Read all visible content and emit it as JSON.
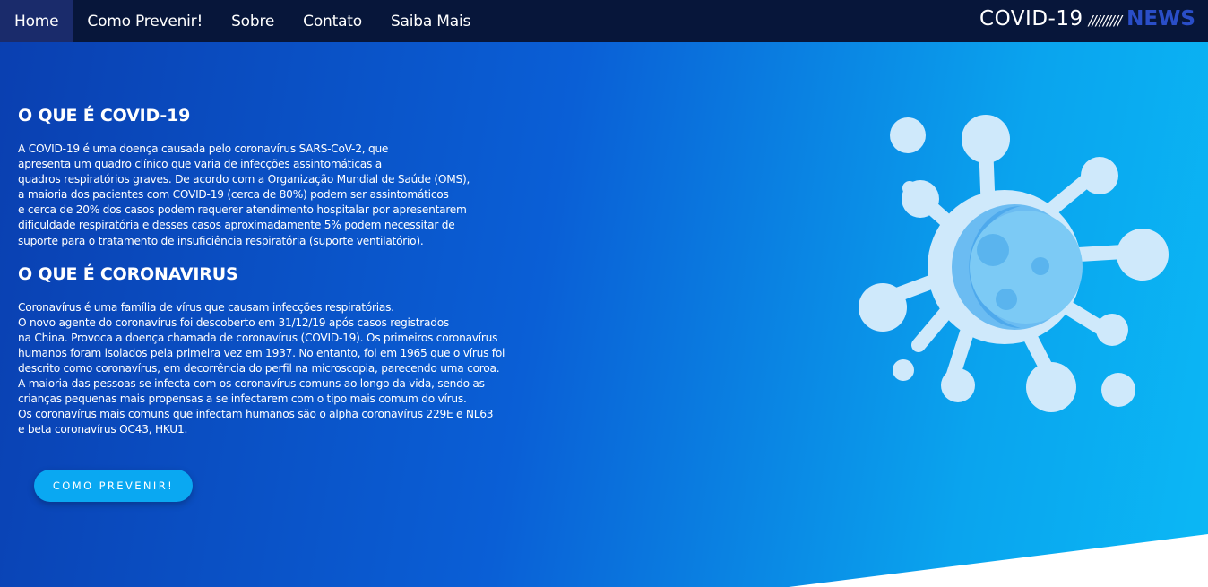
{
  "nav": {
    "items": [
      {
        "label": "Home",
        "active": true
      },
      {
        "label": "Como Prevenir!",
        "active": false
      },
      {
        "label": "Sobre",
        "active": false
      },
      {
        "label": "Contato",
        "active": false
      },
      {
        "label": "Saiba Mais",
        "active": false
      }
    ]
  },
  "brand": {
    "main": "COVID-19",
    "slashes": "/////////",
    "news": "NEWS"
  },
  "sections": [
    {
      "title": "O QUE É COVID-19",
      "text": "A COVID-19 é uma doença causada pelo coronavírus SARS-CoV-2, que\napresenta um quadro clínico que varia de infecções assintomáticas a\nquadros respiratórios graves. De acordo com a Organização Mundial de Saúde (OMS),\na maioria dos pacientes com COVID-19 (cerca de 80%) podem ser assintomáticos\ne cerca de 20% dos casos podem requerer atendimento hospitalar por apresentarem\ndificuldade respiratória e desses casos aproximadamente 5% podem necessitar de\nsuporte para o tratamento de insuficiência respiratória (suporte ventilatório)."
    },
    {
      "title": "O QUE É CORONAVIRUS",
      "text": "Coronavírus é uma família de vírus que causam infecções respiratórias.\nO novo agente do coronavírus foi descoberto em 31/12/19 após casos registrados\nna China. Provoca a doença chamada de coronavírus (COVID-19). Os primeiros coronavírus\nhumanos foram isolados pela primeira vez em 1937. No entanto, foi em 1965 que o vírus foi\ndescrito como coronavírus, em decorrência do perfil na microscopia, parecendo uma coroa.\nA maioria das pessoas se infecta com os coronavírus comuns ao longo da vida, sendo as\ncrianças pequenas mais propensas a se infectarem com o tipo mais comum do vírus.\nOs coronavírus mais comuns que infectam humanos são o alpha coronavírus 229E e NL63\ne beta coronavírus OC43, HKU1."
    }
  ],
  "cta": {
    "label": "COMO PREVENIR!"
  },
  "icons": {
    "illustration": "virus-illustration"
  },
  "colors": {
    "nav_bg": "#07163a",
    "nav_active": "#1a2b6b",
    "brand_news": "#2a4ec8",
    "cta_bg": "#0aa8f2",
    "virus_light": "#cfe9fb",
    "virus_mid": "#7cc8f4",
    "virus_dark": "#5ab4ee"
  }
}
